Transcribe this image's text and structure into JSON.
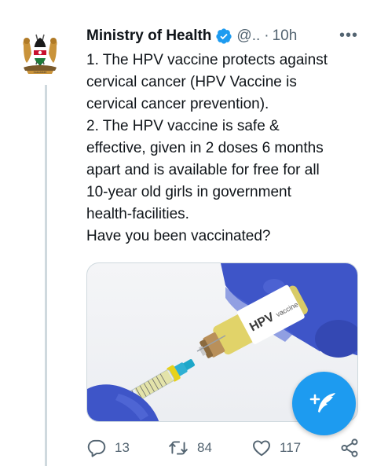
{
  "tweet": {
    "author_name": "Ministry of Health",
    "handle": "@..",
    "separator": "·",
    "time": "10h",
    "more_label": "•••",
    "lines": [
      "1. The HPV vaccine protects against",
      "cervical cancer (HPV Vaccine is",
      "cervical cancer prevention).",
      "2. The HPV vaccine is safe &",
      "effective, given in 2 doses 6 months",
      "apart and is available for free for all",
      "10-year old girls in government",
      "health-facilities.",
      "Have you been vaccinated?"
    ],
    "media": {
      "label_brand": "HPV",
      "label_word": "vaccine"
    },
    "stats": {
      "replies": "13",
      "retweets": "84",
      "likes": "117"
    }
  },
  "colors": {
    "accent": "#1d9bf0",
    "muted": "#536471",
    "text": "#0f1419",
    "glove": "#3e55c8",
    "liquid": "#d8c21a"
  },
  "icons": {
    "verified": "verified-badge-icon",
    "reply": "reply-icon",
    "retweet": "retweet-icon",
    "like": "heart-icon",
    "share": "share-icon",
    "compose": "compose-tweet-icon",
    "avatar": "kenya-coat-of-arms-icon"
  }
}
